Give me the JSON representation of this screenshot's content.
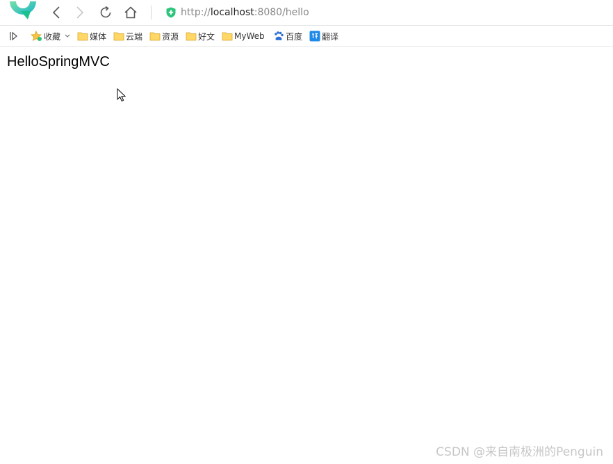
{
  "browser": {
    "url_scheme": "http://",
    "url_host": "localhost",
    "url_rest": ":8080/hello",
    "accent_color": "#2bc47a"
  },
  "bookmarks": [
    {
      "label": "收藏",
      "icon": "star-icon"
    },
    {
      "label": "媒体",
      "icon": "folder-icon"
    },
    {
      "label": "云端",
      "icon": "folder-icon"
    },
    {
      "label": "资源",
      "icon": "folder-icon"
    },
    {
      "label": "好文",
      "icon": "folder-icon"
    },
    {
      "label": "MyWeb",
      "icon": "folder-icon"
    },
    {
      "label": "百度",
      "icon": "baidu-paw-icon"
    },
    {
      "label": "翻译",
      "icon": "translate-icon"
    }
  ],
  "page": {
    "heading": "HelloSpringMVC"
  },
  "watermark": "CSDN @来自南极洲的Penguin"
}
